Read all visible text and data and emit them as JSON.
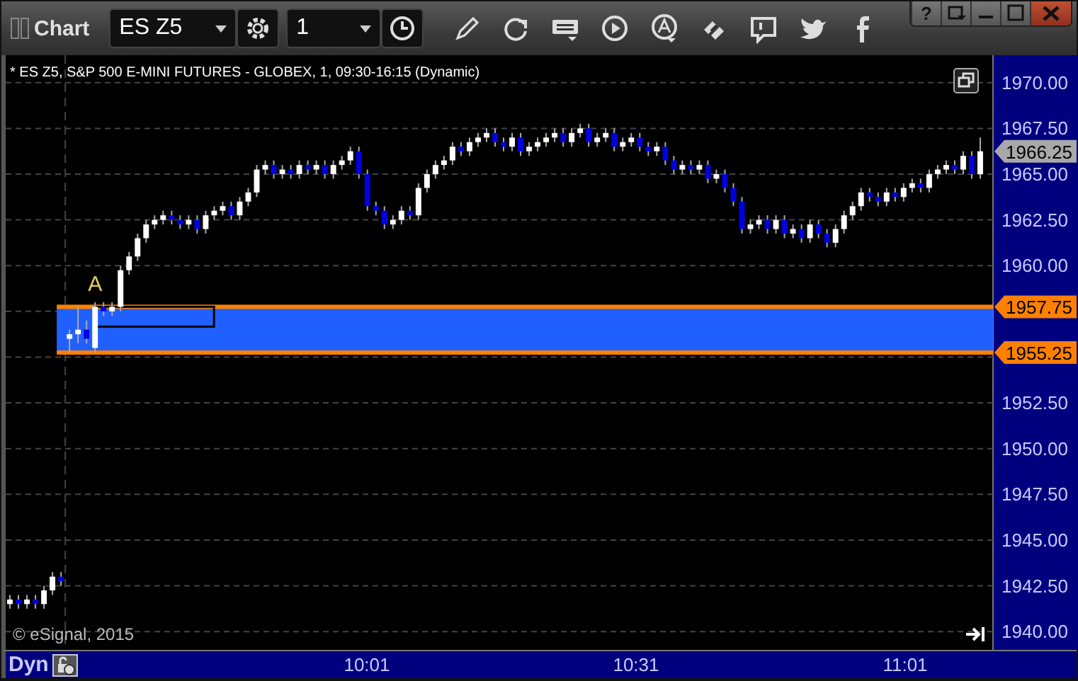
{
  "window": {
    "title": "Chart",
    "help": "?"
  },
  "toolbar": {
    "symbol": "ES Z5",
    "interval": "1"
  },
  "chart": {
    "header": "* ES Z5, S&P 500 E-MINI FUTURES - GLOBEX, 1, 09:30-16:15 (Dynamic)",
    "copyright": "© eSignal, 2015",
    "chart_data": {
      "type": "candlestick",
      "categories": [
        null,
        null,
        null,
        null,
        null,
        null,
        null,
        null,
        null,
        null,
        null,
        null,
        null,
        null,
        null,
        null,
        null,
        null,
        null,
        null,
        null,
        null,
        null,
        null,
        null,
        null,
        null,
        null,
        null,
        null,
        null,
        null,
        null,
        null,
        null,
        null,
        null,
        null,
        null,
        null,
        null,
        null,
        null,
        null,
        null,
        null,
        null,
        null,
        null,
        null,
        null,
        null,
        null,
        null,
        null,
        null,
        null,
        null,
        null,
        null,
        null,
        null,
        null,
        null,
        null,
        null,
        null,
        null,
        null,
        null,
        null,
        null,
        null,
        null,
        null,
        null,
        null,
        null,
        null,
        null,
        null,
        null,
        null,
        null,
        null,
        null,
        null,
        null,
        null,
        null,
        null,
        null,
        null,
        null,
        null,
        null,
        null,
        null,
        null,
        null,
        null,
        null,
        null,
        null,
        null,
        null,
        null,
        null,
        null,
        null,
        null,
        null,
        null,
        null,
        null
      ],
      "ohlc": [
        [
          1941.5,
          1942,
          1941.25,
          1941.75
        ],
        [
          1941.75,
          1942,
          1941.25,
          1941.5
        ],
        [
          1941.5,
          1942,
          1941.25,
          1941.75
        ],
        [
          1941.75,
          1942,
          1941.25,
          1941.5
        ],
        [
          1941.5,
          1942.5,
          1941.25,
          1942.25
        ],
        [
          1942.25,
          1943.25,
          1942,
          1943
        ],
        [
          1943,
          1943.25,
          1942.5,
          1942.75
        ],
        [
          1956,
          1956.5,
          1955.25,
          1956.25
        ],
        [
          1956.25,
          1957.75,
          1955.75,
          1956.5
        ],
        [
          1956.5,
          1957,
          1955.75,
          1956
        ],
        [
          1955.5,
          1958,
          1955.25,
          1957.75
        ],
        [
          1957.75,
          1958,
          1957.25,
          1957.5
        ],
        [
          1957.5,
          1958,
          1957.25,
          1957.75
        ],
        [
          1957.75,
          1960,
          1957.5,
          1959.75
        ],
        [
          1959.75,
          1960.75,
          1959.5,
          1960.5
        ],
        [
          1960.5,
          1961.75,
          1960.25,
          1961.5
        ],
        [
          1961.5,
          1962.5,
          1961.25,
          1962.25
        ],
        [
          1962.25,
          1962.75,
          1962,
          1962.5
        ],
        [
          1962.5,
          1963,
          1962.25,
          1962.75
        ],
        [
          1962.75,
          1963,
          1962.25,
          1962.5
        ],
        [
          1962.5,
          1962.75,
          1962,
          1962.25
        ],
        [
          1962.25,
          1962.75,
          1962,
          1962.5
        ],
        [
          1962.5,
          1962.75,
          1961.75,
          1962
        ],
        [
          1962,
          1963,
          1961.75,
          1962.75
        ],
        [
          1962.75,
          1963.25,
          1962.5,
          1963
        ],
        [
          1963,
          1963.5,
          1962.75,
          1963.25
        ],
        [
          1963.25,
          1963.5,
          1962.5,
          1962.75
        ],
        [
          1962.75,
          1963.75,
          1962.5,
          1963.5
        ],
        [
          1963.5,
          1964.25,
          1963.25,
          1964
        ],
        [
          1964,
          1965.5,
          1963.75,
          1965.25
        ],
        [
          1965.25,
          1965.75,
          1965,
          1965.5
        ],
        [
          1965.5,
          1965.75,
          1964.75,
          1965
        ],
        [
          1965,
          1965.5,
          1964.75,
          1965.25
        ],
        [
          1965.25,
          1965.5,
          1964.75,
          1965
        ],
        [
          1965,
          1965.75,
          1964.75,
          1965.5
        ],
        [
          1965.5,
          1965.75,
          1965,
          1965.25
        ],
        [
          1965.25,
          1965.75,
          1965,
          1965.5
        ],
        [
          1965.5,
          1965.75,
          1964.75,
          1965
        ],
        [
          1965,
          1965.75,
          1964.75,
          1965.5
        ],
        [
          1965.5,
          1966,
          1965.25,
          1965.75
        ],
        [
          1965.75,
          1966.5,
          1965.5,
          1966.25
        ],
        [
          1966.25,
          1966.5,
          1964.75,
          1965
        ],
        [
          1965,
          1965.25,
          1963,
          1963.25
        ],
        [
          1963.25,
          1963.5,
          1962.75,
          1963
        ],
        [
          1963,
          1963.25,
          1962,
          1962.25
        ],
        [
          1962.25,
          1962.75,
          1962,
          1962.5
        ],
        [
          1962.5,
          1963.25,
          1962.25,
          1963
        ],
        [
          1963,
          1963.25,
          1962.5,
          1962.75
        ],
        [
          1962.75,
          1964.5,
          1962.5,
          1964.25
        ],
        [
          1964.25,
          1965.25,
          1964,
          1965
        ],
        [
          1965,
          1965.75,
          1964.75,
          1965.5
        ],
        [
          1965.5,
          1966,
          1965.25,
          1965.75
        ],
        [
          1965.75,
          1966.75,
          1965.5,
          1966.5
        ],
        [
          1966.5,
          1966.75,
          1966,
          1966.25
        ],
        [
          1966.25,
          1967,
          1966,
          1966.75
        ],
        [
          1966.75,
          1967.25,
          1966.5,
          1967
        ],
        [
          1967,
          1967.5,
          1966.75,
          1967.25
        ],
        [
          1967.25,
          1967.5,
          1966.5,
          1966.75
        ],
        [
          1966.75,
          1967,
          1966.25,
          1966.5
        ],
        [
          1966.5,
          1967.25,
          1966.25,
          1967
        ],
        [
          1967,
          1967.25,
          1966,
          1966.25
        ],
        [
          1966.25,
          1966.75,
          1966,
          1966.5
        ],
        [
          1966.5,
          1967,
          1966.25,
          1966.75
        ],
        [
          1966.75,
          1967.25,
          1966.5,
          1967
        ],
        [
          1967,
          1967.5,
          1966.75,
          1967.25
        ],
        [
          1967.25,
          1967.5,
          1966.5,
          1966.75
        ],
        [
          1966.75,
          1967.5,
          1966.5,
          1967.25
        ],
        [
          1967.25,
          1967.75,
          1967,
          1967.5
        ],
        [
          1967.5,
          1967.75,
          1966.5,
          1966.75
        ],
        [
          1966.75,
          1967.25,
          1966.5,
          1967
        ],
        [
          1967,
          1967.5,
          1966.75,
          1967.25
        ],
        [
          1967.25,
          1967.5,
          1966.25,
          1966.5
        ],
        [
          1966.5,
          1967,
          1966.25,
          1966.75
        ],
        [
          1966.75,
          1967.25,
          1966.5,
          1967
        ],
        [
          1967,
          1967.25,
          1966.25,
          1966.5
        ],
        [
          1966.5,
          1966.75,
          1966,
          1966.25
        ],
        [
          1966.25,
          1966.75,
          1966,
          1966.5
        ],
        [
          1966.5,
          1966.75,
          1965.5,
          1965.75
        ],
        [
          1965.75,
          1966,
          1965,
          1965.25
        ],
        [
          1965.25,
          1965.75,
          1965,
          1965.5
        ],
        [
          1965.5,
          1965.75,
          1965,
          1965.25
        ],
        [
          1965.25,
          1965.75,
          1965,
          1965.5
        ],
        [
          1965.5,
          1965.75,
          1964.5,
          1964.75
        ],
        [
          1964.75,
          1965.25,
          1964.5,
          1965
        ],
        [
          1965,
          1965.25,
          1964,
          1964.25
        ],
        [
          1964.25,
          1964.5,
          1963.25,
          1963.5
        ],
        [
          1963.5,
          1963.75,
          1961.75,
          1962
        ],
        [
          1962,
          1962.5,
          1961.75,
          1962.25
        ],
        [
          1962.25,
          1962.75,
          1962,
          1962.5
        ],
        [
          1962.5,
          1962.75,
          1961.75,
          1962
        ],
        [
          1962,
          1962.75,
          1961.75,
          1962.5
        ],
        [
          1962.5,
          1962.75,
          1961.5,
          1961.75
        ],
        [
          1961.75,
          1962.25,
          1961.5,
          1962
        ],
        [
          1962,
          1962.25,
          1961.25,
          1961.5
        ],
        [
          1961.5,
          1962.5,
          1961.25,
          1962.25
        ],
        [
          1962.25,
          1962.5,
          1961.5,
          1961.75
        ],
        [
          1961.75,
          1962,
          1961,
          1961.25
        ],
        [
          1961.25,
          1962.25,
          1961,
          1962
        ],
        [
          1962,
          1963,
          1961.75,
          1962.75
        ],
        [
          1962.75,
          1963.5,
          1962.5,
          1963.25
        ],
        [
          1963.25,
          1964.25,
          1963,
          1964
        ],
        [
          1964,
          1964.25,
          1963.5,
          1963.75
        ],
        [
          1963.75,
          1964,
          1963.25,
          1963.5
        ],
        [
          1963.5,
          1964.25,
          1963.25,
          1964
        ],
        [
          1964,
          1964.25,
          1963.5,
          1963.75
        ],
        [
          1963.75,
          1964.5,
          1963.5,
          1964.25
        ],
        [
          1964.25,
          1964.75,
          1964,
          1964.5
        ],
        [
          1964.5,
          1964.75,
          1964,
          1964.25
        ],
        [
          1964.25,
          1965.25,
          1964,
          1965
        ],
        [
          1965,
          1965.5,
          1964.75,
          1965.25
        ],
        [
          1965.25,
          1965.75,
          1965,
          1965.5
        ],
        [
          1965.5,
          1965.75,
          1965,
          1965.25
        ],
        [
          1965.25,
          1966.25,
          1965,
          1966
        ],
        [
          1966,
          1966.25,
          1964.75,
          1965
        ],
        [
          1965,
          1967,
          1964.75,
          1966.25
        ]
      ],
      "ylim": [
        1939,
        1971.5
      ],
      "grid": true,
      "yticks": [
        {
          "value": 1970,
          "label": "1970.00"
        },
        {
          "value": 1967.5,
          "label": "1967.50"
        },
        {
          "value": 1965,
          "label": "1965.00"
        },
        {
          "value": 1962.5,
          "label": "1962.50"
        },
        {
          "value": 1960,
          "label": "1960.00"
        },
        {
          "value": 1952.5,
          "label": "1952.50"
        },
        {
          "value": 1950,
          "label": "1950.00"
        },
        {
          "value": 1947.5,
          "label": "1947.50"
        },
        {
          "value": 1945,
          "label": "1945.00"
        },
        {
          "value": 1942.5,
          "label": "1942.50"
        },
        {
          "value": 1940,
          "label": "1940.00"
        }
      ],
      "annotations": [
        "A"
      ]
    },
    "price_markers": [
      {
        "label": "1966.25",
        "color": "#a8a8a8"
      },
      {
        "label": "1957.75",
        "color": "#ff8000"
      },
      {
        "label": "1955.25",
        "color": "#ff8000"
      }
    ]
  },
  "bottom_bar": {
    "mode": "Dyn",
    "x_axis": [
      "10:01",
      "10:31",
      "11:01"
    ]
  }
}
